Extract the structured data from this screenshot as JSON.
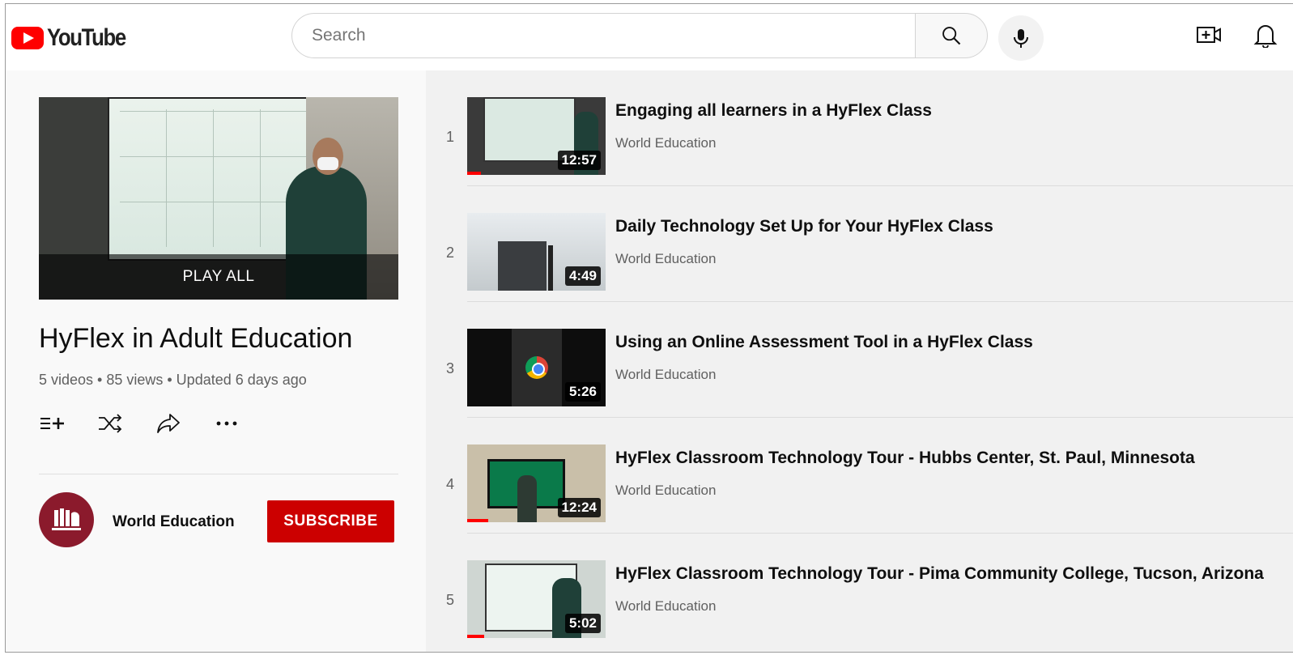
{
  "header": {
    "logo_text": "YouTube",
    "search_placeholder": "Search"
  },
  "playlist": {
    "play_all": "PLAY ALL",
    "title": "HyFlex in Adult Education",
    "meta": "5 videos • 85 views • Updated 6 days ago",
    "channel": "World Education",
    "subscribe": "SUBSCRIBE"
  },
  "videos": [
    {
      "index": "1",
      "title": "Engaging all learners in a HyFlex Class",
      "channel": "World Education",
      "duration": "12:57",
      "watched_fraction": 0.1
    },
    {
      "index": "2",
      "title": "Daily Technology Set Up for Your HyFlex Class",
      "channel": "World Education",
      "duration": "4:49",
      "watched_fraction": 0
    },
    {
      "index": "3",
      "title": "Using an Online Assessment Tool in a HyFlex Class",
      "channel": "World Education",
      "duration": "5:26",
      "watched_fraction": 0
    },
    {
      "index": "4",
      "title": "HyFlex Classroom Technology Tour - Hubbs Center, St. Paul, Minnesota",
      "channel": "World Education",
      "duration": "12:24",
      "watched_fraction": 0.15
    },
    {
      "index": "5",
      "title": "HyFlex Classroom Technology Tour - Pima Community College, Tucson, Arizona",
      "channel": "World Education",
      "duration": "5:02",
      "watched_fraction": 0.12
    }
  ],
  "colors": {
    "brand_red": "#ff0000",
    "subscribe_red": "#cc0000",
    "avatar": "#8b1a2c"
  },
  "icons": [
    "youtube-logo-icon",
    "search-icon",
    "mic-icon",
    "create-video-icon",
    "bell-icon",
    "add-to-queue-icon",
    "shuffle-icon",
    "share-icon",
    "more-icon",
    "world-education-logo-icon"
  ]
}
